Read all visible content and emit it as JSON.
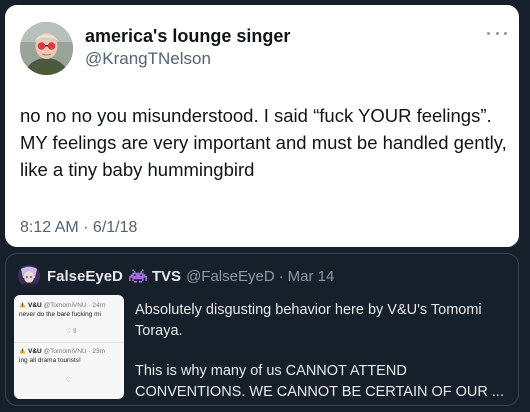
{
  "tweet": {
    "display_name": "america's lounge singer",
    "handle": "@KrangTNelson",
    "text": "no no no you misunderstood. I said “fuck YOUR feelings”. MY feelings are very important and must be handled gently, like a tiny baby hummingbird",
    "timestamp": "8:12 AM · 6/1/18",
    "more_icon": "more-horizontal-icon"
  },
  "quote": {
    "display_name": "FalseEyeD",
    "emoji_icon": "space-invader-icon",
    "display_suffix": "TVS",
    "handle": "@FalseEyeD",
    "separator": "·",
    "date": "Mar 14",
    "text_paragraph_1": "Absolutely disgusting behavior here by V&U's Tomomi Toraya.",
    "text_paragraph_2": "This is why many of us CANNOT ATTEND CONVENTIONS. WE CANNOT BE CERTAIN OF OUR ...",
    "media": {
      "post_1": {
        "name": "V&U",
        "handle": "@TomomiVNU · 24m",
        "text": "never do the bare fucking mi",
        "likes": "5"
      },
      "post_2": {
        "name": "V&U",
        "handle": "@TomomiVNU · 23m",
        "text": "ing all drama tourists!",
        "likes": ""
      }
    }
  },
  "colors": {
    "background": "#15202b",
    "card": "#ffffff",
    "text_primary_light": "#0f1419",
    "text_secondary_light": "#536471",
    "text_primary_dark": "#e7e9ea",
    "text_secondary_dark": "#8b98a5",
    "quote_border": "#38444d"
  }
}
